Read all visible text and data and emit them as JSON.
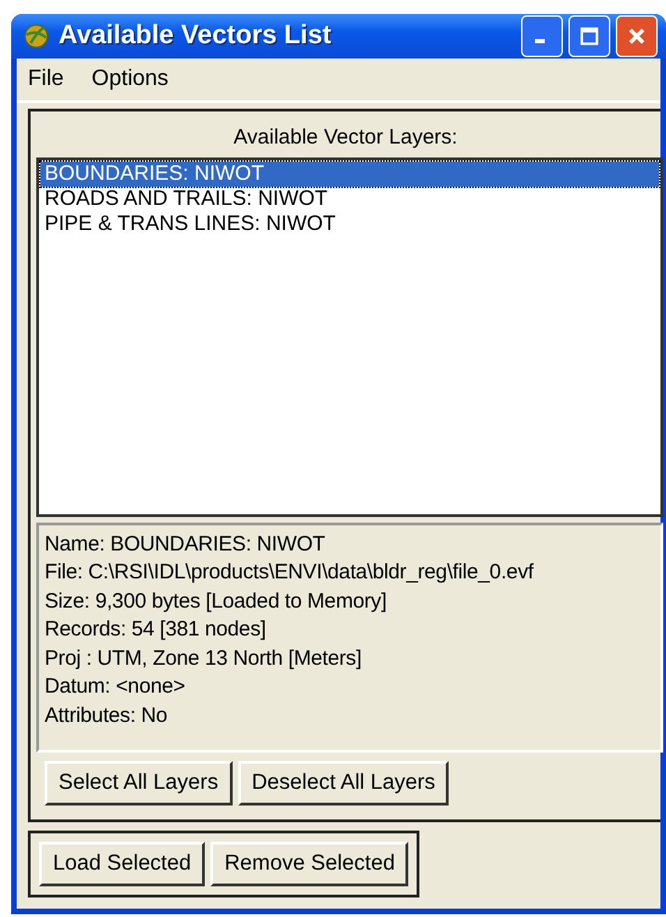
{
  "window": {
    "title": "Available Vectors List"
  },
  "menu": [
    "File",
    "Options"
  ],
  "layers": {
    "heading": "Available Vector Layers:",
    "items": [
      {
        "label": "BOUNDARIES: NIWOT",
        "selected": true
      },
      {
        "label": "ROADS AND TRAILS: NIWOT",
        "selected": false
      },
      {
        "label": "PIPE & TRANS LINES: NIWOT",
        "selected": false
      }
    ]
  },
  "info": [
    "Name: BOUNDARIES: NIWOT",
    "File: C:\\RSI\\IDL\\products\\ENVI\\data\\bldr_reg\\file_0.evf",
    "Size: 9,300 bytes [Loaded to Memory]",
    "Records: 54 [381 nodes]",
    "Proj : UTM, Zone 13 North [Meters]",
    "Datum: <none>",
    "Attributes: No"
  ],
  "layer_buttons": [
    "Select All Layers",
    "Deselect All Layers"
  ],
  "action_buttons": [
    "Load Selected",
    "Remove Selected"
  ]
}
